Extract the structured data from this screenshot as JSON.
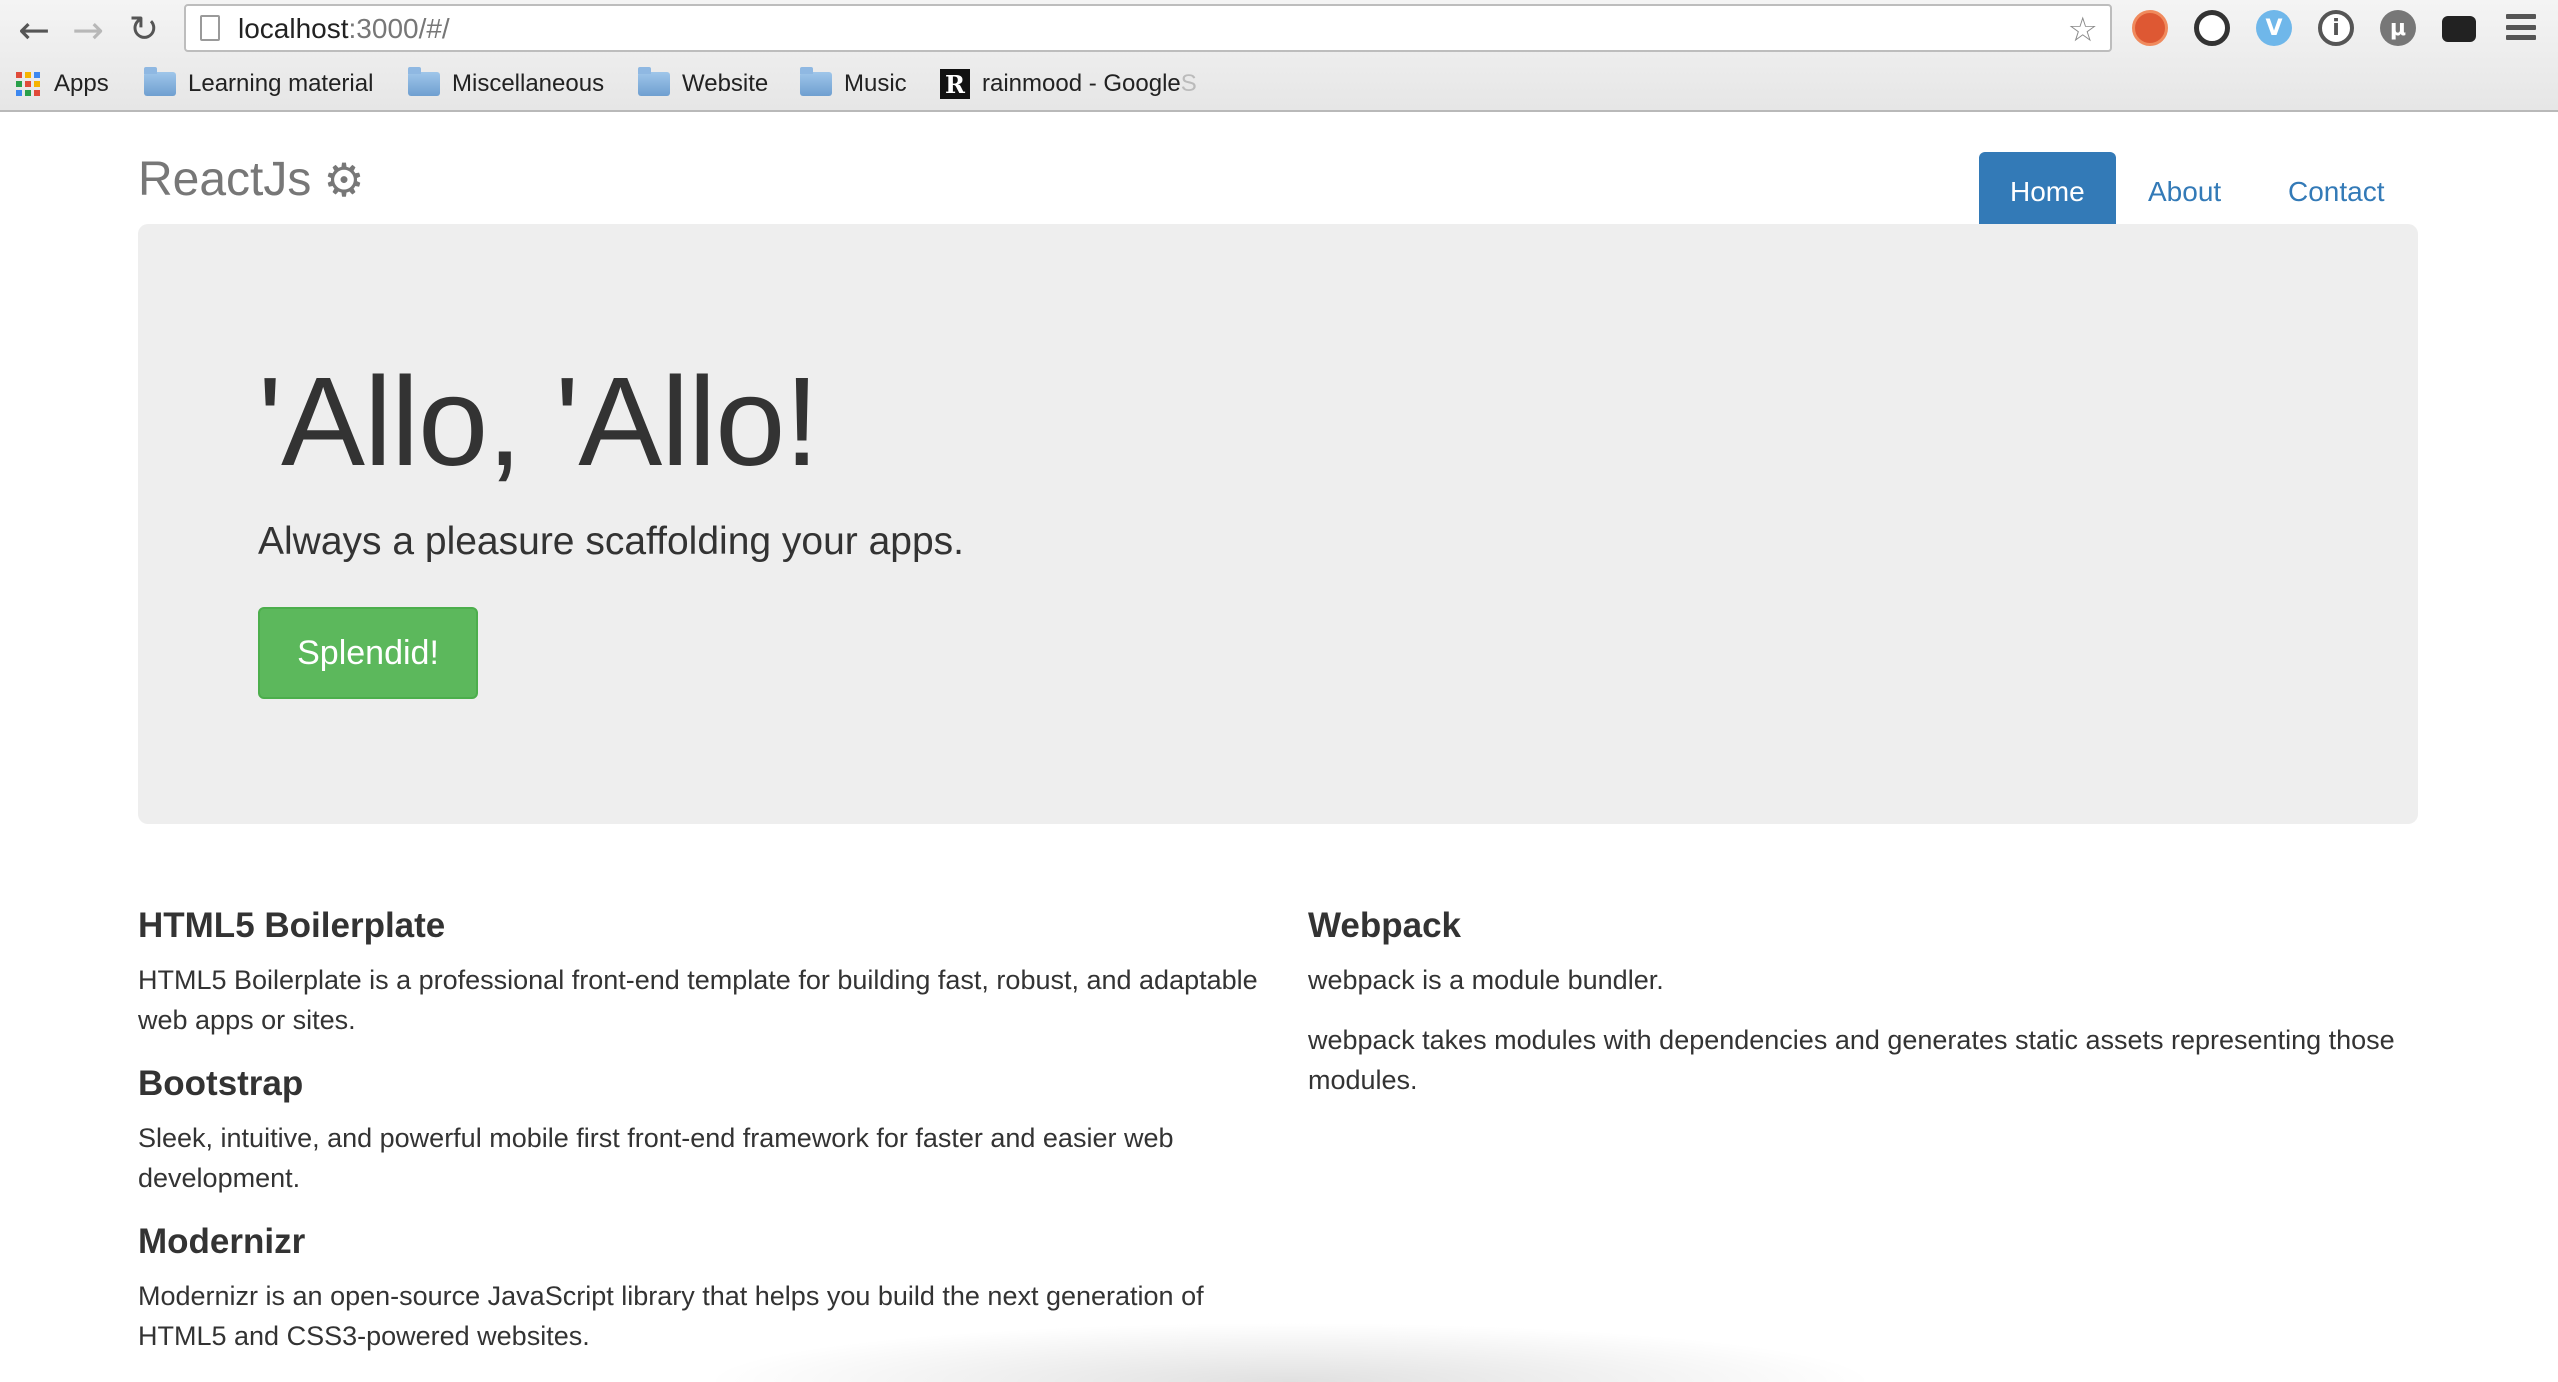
{
  "browser": {
    "url_host": "localhost",
    "url_rest": ":3000/#/",
    "bookmarks": [
      {
        "label": "Apps",
        "icon": "apps-grid-icon"
      },
      {
        "label": "Learning material",
        "icon": "folder-icon"
      },
      {
        "label": "Miscellaneous",
        "icon": "folder-icon"
      },
      {
        "label": "Website",
        "icon": "folder-icon"
      },
      {
        "label": "Music",
        "icon": "folder-icon"
      },
      {
        "label": "rainmood - Google ",
        "fade": "S",
        "icon": "r-badge-icon"
      }
    ],
    "r_badge_letter": "R",
    "extension_glyphs": [
      "",
      "",
      "V",
      "i",
      "μ",
      ""
    ]
  },
  "header": {
    "brand": "ReactJs",
    "nav": [
      {
        "label": "Home",
        "active": true
      },
      {
        "label": "About",
        "active": false
      },
      {
        "label": "Contact",
        "active": false
      }
    ]
  },
  "jumbotron": {
    "title": "'Allo, 'Allo!",
    "subtitle": "Always a pleasure scaffolding your apps.",
    "button": "Splendid!"
  },
  "left_column": [
    {
      "heading": "HTML5 Boilerplate",
      "paragraphs": [
        "HTML5 Boilerplate is a professional front-end template for building fast, robust, and adaptable web apps or sites."
      ]
    },
    {
      "heading": "Bootstrap",
      "paragraphs": [
        "Sleek, intuitive, and powerful mobile first front-end framework for faster and easier web development."
      ]
    },
    {
      "heading": "Modernizr",
      "paragraphs": [
        "Modernizr is an open-source JavaScript library that helps you build the next generation of HTML5 and CSS3-powered websites."
      ]
    }
  ],
  "right_column": [
    {
      "heading": "Webpack",
      "paragraphs": [
        "webpack is a module bundler.",
        "webpack takes modules with dependencies and generates static assets representing those modules."
      ]
    }
  ],
  "colors": {
    "primary": "#337ab7",
    "success": "#5cb85c",
    "jumbotron_bg": "#eeeeee",
    "brand_text": "#777777"
  }
}
